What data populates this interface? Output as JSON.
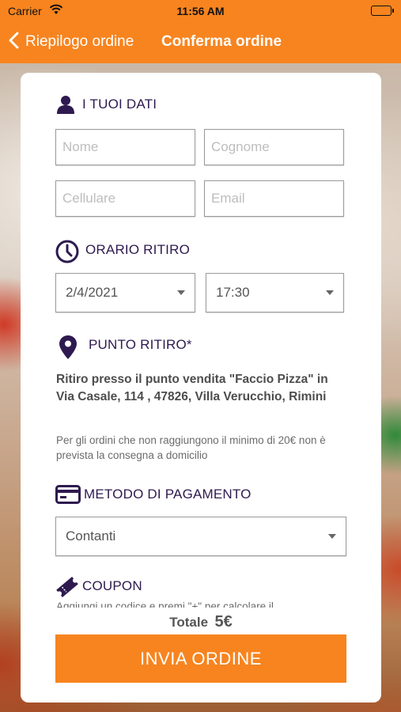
{
  "status_bar": {
    "carrier": "Carrier",
    "time": "11:56 AM"
  },
  "nav": {
    "back_label": "Riepilogo ordine",
    "title": "Conferma ordine"
  },
  "sections": {
    "personal": {
      "title": "I TUOI DATI",
      "icon": "user-icon"
    },
    "pickup_time": {
      "title": "ORARIO RITIRO",
      "icon": "clock-icon"
    },
    "pickup_point": {
      "title": "PUNTO RITIRO*",
      "icon": "location-pin-icon"
    },
    "payment": {
      "title": "METODO DI PAGAMENTO",
      "icon": "credit-card-icon"
    },
    "coupon": {
      "title": "COUPON",
      "icon": "ticket-icon"
    }
  },
  "form": {
    "name": {
      "value": "",
      "placeholder": "Nome"
    },
    "surname": {
      "value": "",
      "placeholder": "Cognome"
    },
    "phone": {
      "value": "",
      "placeholder": "Cellulare"
    },
    "email": {
      "value": "",
      "placeholder": "Email"
    },
    "date": "2/4/2021",
    "time": "17:30",
    "payment_method": "Contanti"
  },
  "pickup_info": {
    "address": "Ritiro presso il punto vendita \"Faccio Pizza\" in Via Casale, 114 , 47826, Villa Verucchio, Rimini",
    "note": "Per gli ordini che non raggiungono il minimo di 20€ non è prevista la consegna a domicilio"
  },
  "coupon": {
    "description": "Aggiungi un codice e premi \"+\" per calcolare il"
  },
  "summary": {
    "total_label": "Totale",
    "total_value": "5€",
    "submit_label": "INVIA ORDINE"
  },
  "colors": {
    "accent": "#f7841f",
    "heading": "#2e1a4f"
  }
}
